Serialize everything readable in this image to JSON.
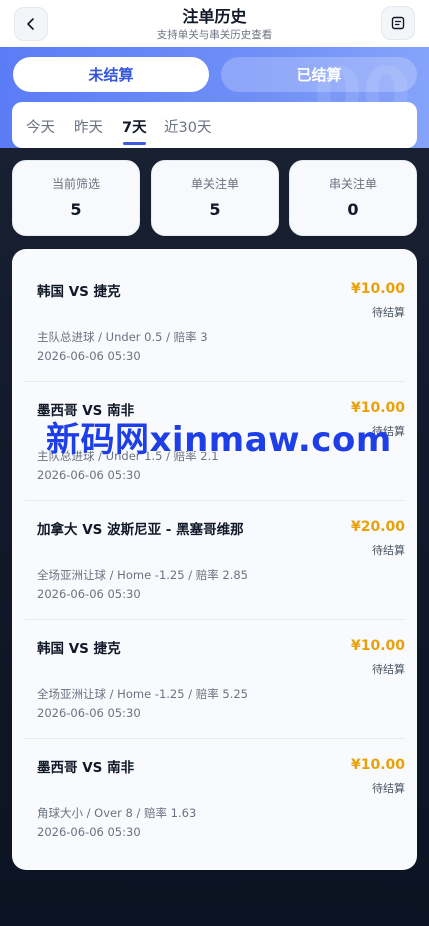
{
  "header": {
    "title": "注单历史",
    "subtitle": "支持单关与串关历史查看",
    "back_icon": "chevron-left-icon",
    "menu_icon": "list-icon"
  },
  "segments": {
    "active": "未结算",
    "inactive": "已结算"
  },
  "periods": [
    "今天",
    "昨天",
    "7天",
    "近30天"
  ],
  "selected_period": "7天",
  "stats": [
    {
      "label": "当前筛选",
      "value": "5"
    },
    {
      "label": "单关注单",
      "value": "5"
    },
    {
      "label": "串关注单",
      "value": "0"
    }
  ],
  "bets": [
    {
      "match": "韩国 VS 捷克",
      "amount": "¥10.00",
      "status": "待结算",
      "detail": "主队总进球 / Under 0.5 / 赔率 3",
      "time": "2026-06-06 05:30"
    },
    {
      "match": "墨西哥 VS 南非",
      "amount": "¥10.00",
      "status": "待结算",
      "detail": "主队总进球 / Under 1.5 / 赔率 2.1",
      "time": "2026-06-06 05:30"
    },
    {
      "match": "加拿大 VS 波斯尼亚 - 黑塞哥维那",
      "amount": "¥20.00",
      "status": "待结算",
      "detail": "全场亚洲让球 / Home -1.25 / 赔率 2.85",
      "time": "2026-06-06 05:30"
    },
    {
      "match": "韩国 VS 捷克",
      "amount": "¥10.00",
      "status": "待结算",
      "detail": "全场亚洲让球 / Home -1.25 / 赔率 5.25",
      "time": "2026-06-06 05:30"
    },
    {
      "match": "墨西哥 VS 南非",
      "amount": "¥10.00",
      "status": "待结算",
      "detail": "角球大小 / Over 8 / 赔率 1.63",
      "time": "2026-06-06 05:30"
    }
  ],
  "watermark": "新码网xinmaw.com",
  "colors": {
    "accent": "#3b5bdb",
    "amount": "#e9a10b"
  }
}
